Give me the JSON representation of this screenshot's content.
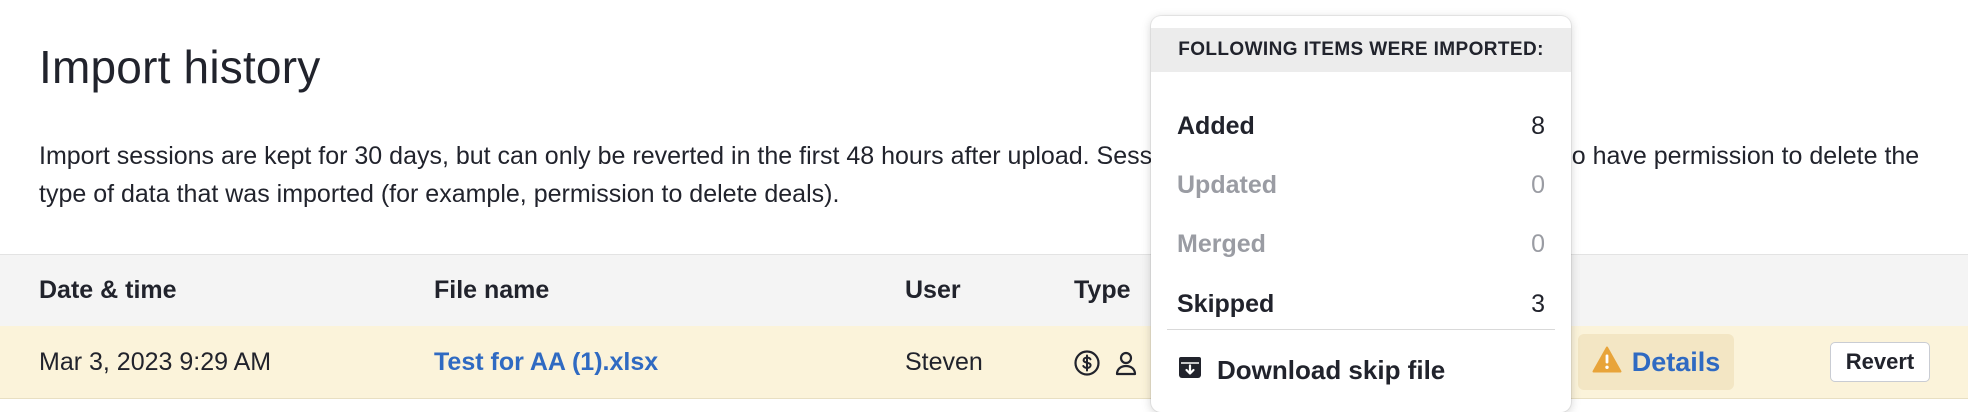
{
  "page": {
    "title": "Import history",
    "description": "Import sessions are kept for 30 days, but can only be reverted in the first 48 hours after upload. Sessions can be reverted only by users who have permission to delete the type of data that was imported (for example, permission to delete deals)."
  },
  "table": {
    "headers": {
      "date": "Date & time",
      "file": "File name",
      "user": "User",
      "type": "Type"
    },
    "rows": [
      {
        "date": "Mar 3, 2023 9:29 AM",
        "file": "Test for AA (1).xlsx",
        "user": "Steven",
        "type_icons": [
          "dollar-circle-icon",
          "person-icon"
        ],
        "details_label": "Details",
        "revert_label": "Revert"
      }
    ]
  },
  "popover": {
    "header": "FOLLOWING ITEMS WERE IMPORTED:",
    "stats": [
      {
        "label": "Added",
        "value": "8"
      },
      {
        "label": "Updated",
        "value": "0"
      },
      {
        "label": "Merged",
        "value": "0"
      },
      {
        "label": "Skipped",
        "value": "3"
      }
    ],
    "download_label": "Download skip file"
  },
  "colors": {
    "link": "#2f6ac2",
    "row_highlight": "#fbf3da",
    "warning": "#e8a43a",
    "muted_text": "#9a9ca3"
  }
}
